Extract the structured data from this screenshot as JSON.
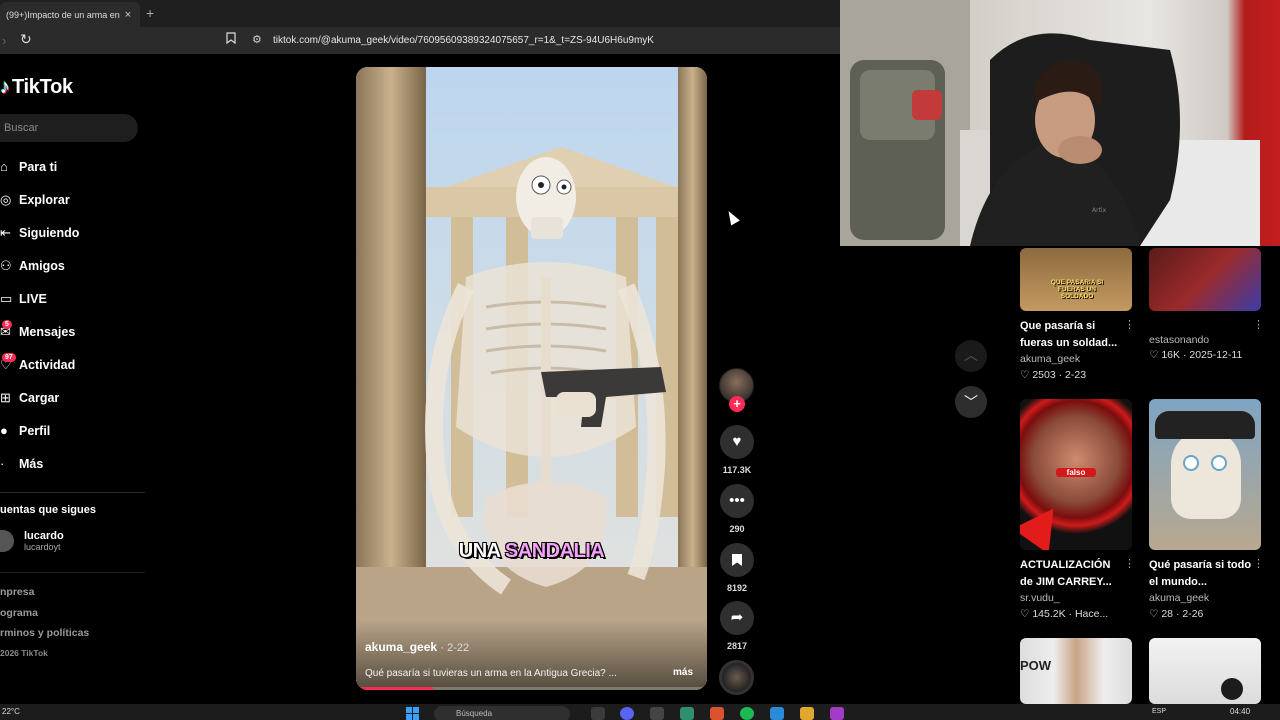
{
  "browser": {
    "tab_title": "(99+)Impacto de un arma en",
    "tab_close": "×",
    "new_tab": "+",
    "url": "tiktok.com/@akuma_geek/video/76095609389324075657_r=1&_t=ZS-94U6H6u9myK"
  },
  "sidebar": {
    "logo": "TikTok",
    "search_placeholder": "Buscar",
    "items": [
      {
        "label": "Para ti",
        "icon": "home-icon"
      },
      {
        "label": "Explorar",
        "icon": "compass-icon"
      },
      {
        "label": "Siguiendo",
        "icon": "following-icon"
      },
      {
        "label": "Amigos",
        "icon": "friends-icon"
      },
      {
        "label": "LIVE",
        "icon": "live-icon"
      },
      {
        "label": "Mensajes",
        "icon": "messages-icon",
        "badge": "5"
      },
      {
        "label": "Actividad",
        "icon": "activity-icon",
        "badge": "97"
      },
      {
        "label": "Cargar",
        "icon": "upload-icon"
      },
      {
        "label": "Perfil",
        "icon": "profile-icon"
      },
      {
        "label": "Más",
        "icon": "more-icon"
      }
    ],
    "following_title": "uentas que sigues",
    "account": {
      "name": "lucardo",
      "handle": "lucardoyt"
    },
    "footer": [
      "npresa",
      "ograma",
      "rminos y políticas",
      "2026 TikTok"
    ]
  },
  "video": {
    "caption_overlay_word1": "UNA",
    "caption_overlay_word2": "SANDALIA",
    "author": "akuma_geek",
    "date": "· 2-22",
    "description": "Qué pasaría si tuvieras un arma en la Antigua Grecia? ...",
    "more": "más",
    "progress_fraction": 0.22
  },
  "actions": {
    "follow_plus": "+",
    "likes": "117.3K",
    "comments": "290",
    "saves": "8192",
    "shares": "2817"
  },
  "related": [
    {
      "title": "Que pasaría si fueras un soldad...",
      "author": "akuma_geek",
      "stats": "2503 · 2-23",
      "thumb_text": "QUE PASARIA SI FUERAS UN SOLDADO"
    },
    {
      "title": "",
      "author": "estasonando",
      "stats": "16K · 2025-12-11",
      "thumb_text": ""
    },
    {
      "title": "ACTUALIZACIÓN de JIM CARREY...",
      "author": "sr.vudu_",
      "stats": "145.2K · Hace...",
      "thumb_text": "falso"
    },
    {
      "title": "Qué pasaría si todo el mundo...",
      "author": "akuma_geek",
      "stats": "28 · 2-26",
      "thumb_text": ""
    },
    {
      "title": "",
      "author": "",
      "stats": "",
      "thumb_text": "POW"
    },
    {
      "title": "",
      "author": "",
      "stats": "",
      "thumb_text": ""
    }
  ],
  "taskbar": {
    "weather": "22°C",
    "search": "Búsqueda",
    "lang": "ESP",
    "time": "04:40"
  },
  "colors": {
    "accent": "#fe2c55",
    "background": "#000000",
    "panel": "#1e1e1e"
  }
}
